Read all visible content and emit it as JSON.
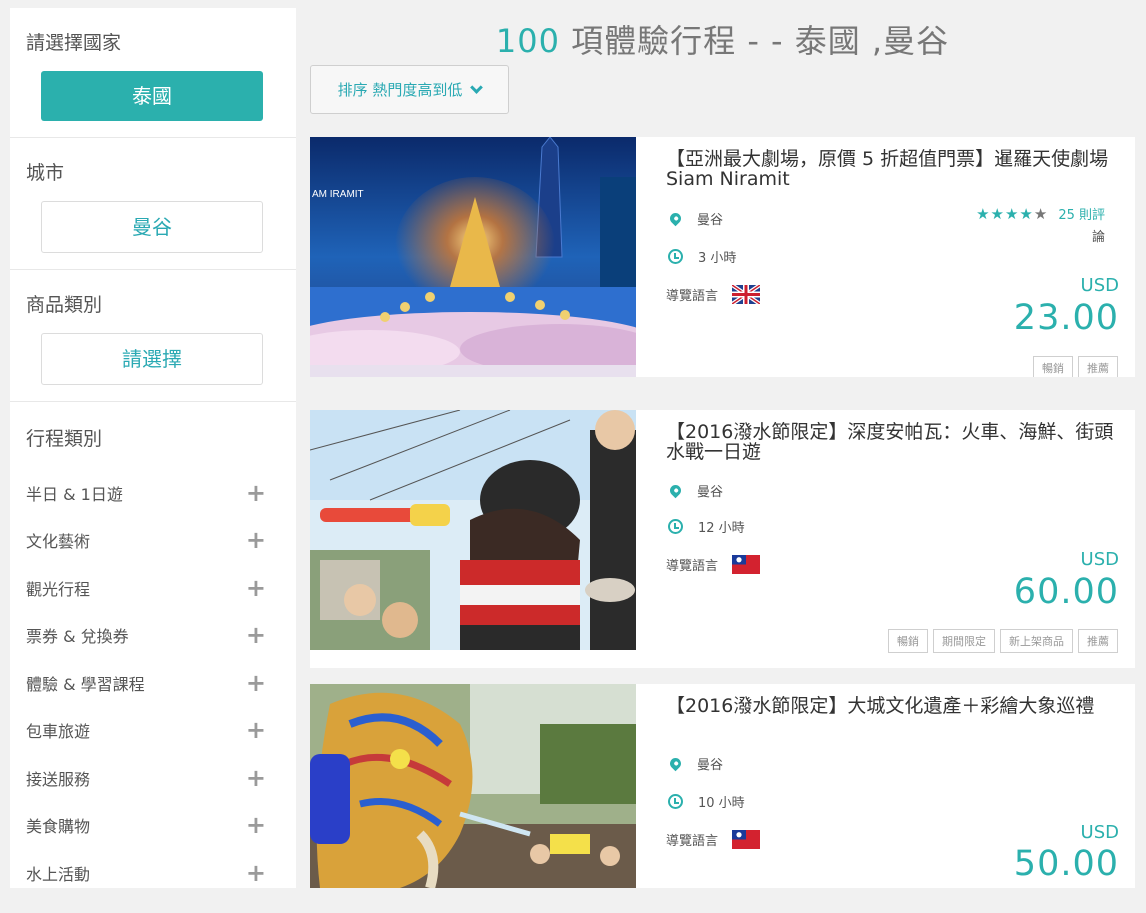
{
  "sidebar": {
    "country": {
      "title": "請選擇國家",
      "value": "泰國"
    },
    "city": {
      "title": "城市",
      "value": "曼谷"
    },
    "product_category": {
      "title": "商品類別",
      "value": "請選擇"
    },
    "trip_category": {
      "title": "行程類別",
      "items": [
        "半日 & 1日遊",
        "文化藝術",
        "觀光行程",
        "票券 & 兌換券",
        "體驗 & 學習課程",
        "包車旅遊",
        "接送服務",
        "美食購物",
        "水上活動"
      ],
      "expand_icon": "plus-icon"
    }
  },
  "header": {
    "count": "100",
    "title_rest": " 項體驗行程 - - 泰國 ,曼谷",
    "sort_label": "排序 熱門度高到低"
  },
  "listings": [
    {
      "title": "【亞洲最大劇場，原價 5 折超值門票】暹羅天使劇場 Siam Niramit",
      "location": "曼谷",
      "duration": "3 小時",
      "language_label": "導覽語言",
      "language_flag": "UK flag",
      "rating_stars": 4.5,
      "rating_text": "25 則評",
      "rating_tail": "論",
      "currency": "USD",
      "price": "23.00",
      "tags": [
        "暢銷",
        "推薦"
      ],
      "image_logo": "AM IRAMIT"
    },
    {
      "title": "【2016潑水節限定】深度安帕瓦：火車、海鮮、街頭水戰一日遊",
      "location": "曼谷",
      "duration": "12 小時",
      "language_label": "導覽語言",
      "language_flag": "Taiwan flag",
      "currency": "USD",
      "price": "60.00",
      "tags": [
        "暢銷",
        "期間限定",
        "新上架商品",
        "推薦"
      ]
    },
    {
      "title": "【2016潑水節限定】大城文化遺產＋彩繪大象巡禮",
      "location": "曼谷",
      "duration": "10 小時",
      "language_label": "導覽語言",
      "language_flag": "Taiwan flag",
      "currency": "USD",
      "price": "50.00",
      "tags": []
    }
  ],
  "colors": {
    "accent": "#2bb0ad",
    "background": "#f1f1f1"
  }
}
